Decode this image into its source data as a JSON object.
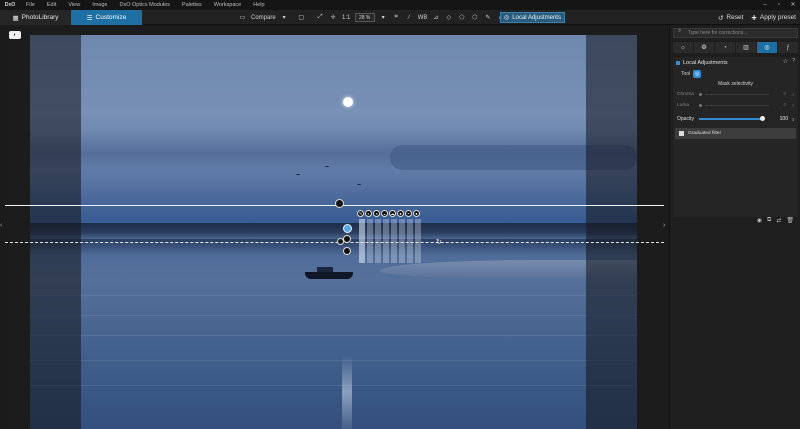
{
  "menu": {
    "logo": "DxO",
    "items": [
      "File",
      "Edit",
      "View",
      "Image",
      "DxO Optics Modules",
      "Palettes",
      "Workspace",
      "Help"
    ],
    "window_controls": [
      "–",
      "▫",
      "✕"
    ]
  },
  "toolbar": {
    "tab_photolibrary": "PhotoLibrary",
    "tab_customize": "Customize",
    "compare_label": "Compare",
    "zoom_1to1": "1:1",
    "zoom_percent": "28 %",
    "wb_label": "WB",
    "local_adjustments": "Local Adjustments",
    "reset_label": "Reset",
    "apply_preset_label": "Apply preset"
  },
  "panel": {
    "search_placeholder": "Type here for corrections...",
    "palette_title": "Local Adjustments",
    "tool_label": "Tool",
    "mask_selectivity": "Mask selectivity",
    "chroma_label": "Chroma",
    "chroma_value": "0",
    "luma_label": "Luma",
    "luma_value": "0",
    "opacity_label": "Opacity",
    "opacity_value": "100",
    "opacity_fraction": 1.0,
    "mask_item": "Graduated filter"
  },
  "colors": {
    "accent": "#1e6fa3",
    "accent_light": "#2f8ed6"
  }
}
